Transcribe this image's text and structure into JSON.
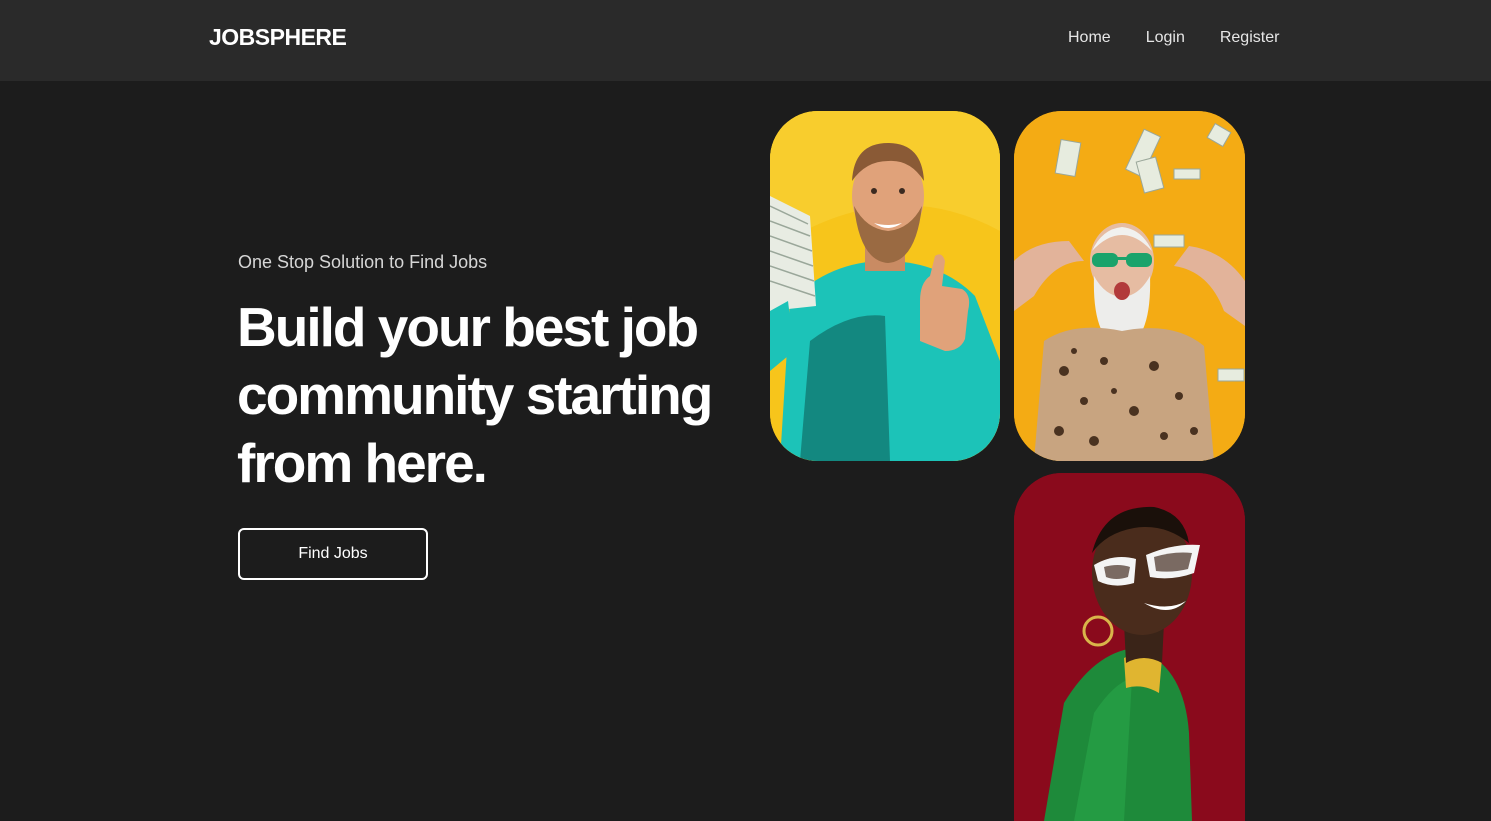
{
  "nav": {
    "brand": "JOBSPHERE",
    "links": [
      {
        "label": "Home"
      },
      {
        "label": "Login"
      },
      {
        "label": "Register"
      }
    ]
  },
  "hero": {
    "tagline": "One Stop Solution to Find Jobs",
    "headline_lines": [
      "Build your best job",
      "community starting",
      "from here."
    ],
    "cta_label": "Find Jobs"
  },
  "colors": {
    "background": "#1c1c1c",
    "navbar": "#2a2a2a",
    "photo_1_bg": "#f7c51b",
    "photo_2_bg": "#f4ab14",
    "photo_3_bg": "#8a0a1c"
  }
}
